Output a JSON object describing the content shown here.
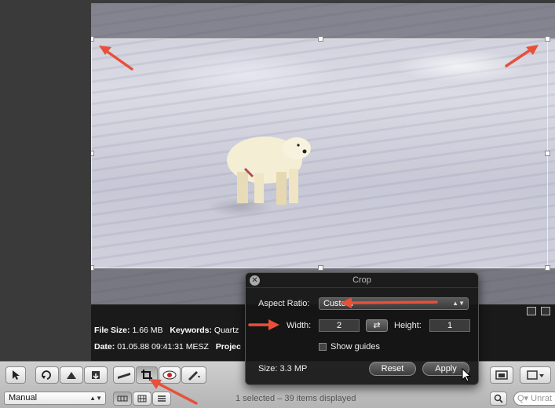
{
  "info": {
    "file_size_label": "File Size:",
    "file_size_value": "1.66 MB",
    "keywords_label": "Keywords:",
    "keywords_value": "Quartz",
    "date_label": "Date:",
    "date_value": "01.05.88 09:41:31 MESZ",
    "project_label": "Projec"
  },
  "hud": {
    "title": "Crop",
    "close_glyph": "✕",
    "aspect_ratio_label": "Aspect Ratio:",
    "aspect_ratio_value": "Custom",
    "width_label": "Width:",
    "width_value": "2",
    "height_label": "Height:",
    "height_value": "1",
    "swap_glyph": "⇄",
    "show_guides_label": "Show guides",
    "size_label": "Size: 3.3 MP",
    "reset_label": "Reset",
    "apply_label": "Apply"
  },
  "toolbar": {
    "view_mode_value": "Manual",
    "status_text": "1 selected – 39 items displayed",
    "search_placeholder": "Q▾ Unrat"
  },
  "colors": {
    "annotation_arrow": "#e8503a",
    "hud_background": "#161616",
    "toolbar_background": "#c4c4c4"
  }
}
